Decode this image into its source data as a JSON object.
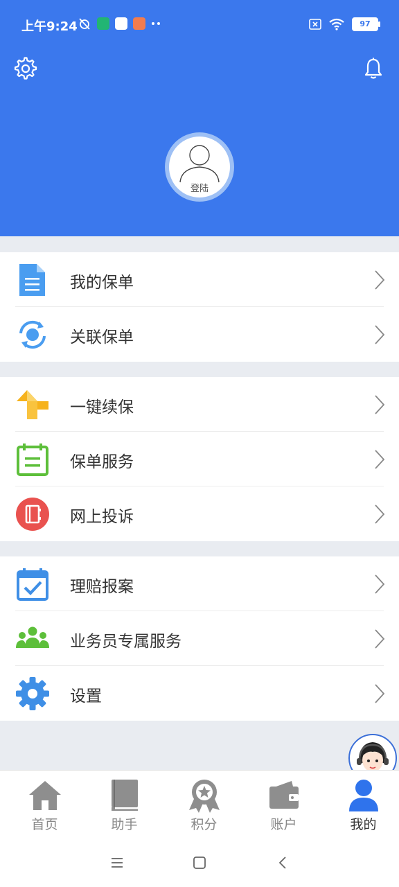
{
  "status_bar": {
    "time": "上午9:24",
    "battery": "97"
  },
  "header": {
    "settings_icon": "gear-icon",
    "bell_icon": "bell-icon",
    "avatar_label": "登陆"
  },
  "menu": {
    "group1": [
      {
        "label": "我的保单",
        "icon": "document-icon"
      },
      {
        "label": "关联保单",
        "icon": "sync-icon"
      }
    ],
    "group2": [
      {
        "label": "一键续保",
        "icon": "origami-icon"
      },
      {
        "label": "保单服务",
        "icon": "clipboard-icon"
      },
      {
        "label": "网上投诉",
        "icon": "notebook-icon"
      }
    ],
    "group3": [
      {
        "label": "理赔报案",
        "icon": "calendar-check-icon"
      },
      {
        "label": "业务员专属服务",
        "icon": "people-icon"
      },
      {
        "label": "设置",
        "icon": "gear-icon"
      }
    ]
  },
  "tabs": [
    {
      "label": "首页",
      "icon": "home-icon"
    },
    {
      "label": "助手",
      "icon": "book-icon"
    },
    {
      "label": "积分",
      "icon": "medal-icon"
    },
    {
      "label": "账户",
      "icon": "wallet-icon"
    },
    {
      "label": "我的",
      "icon": "person-icon",
      "active": true
    }
  ],
  "colors": {
    "brand": "#3b78ed",
    "tab_active": "#2f73ec",
    "tab_inactive": "#8e8e8e"
  }
}
